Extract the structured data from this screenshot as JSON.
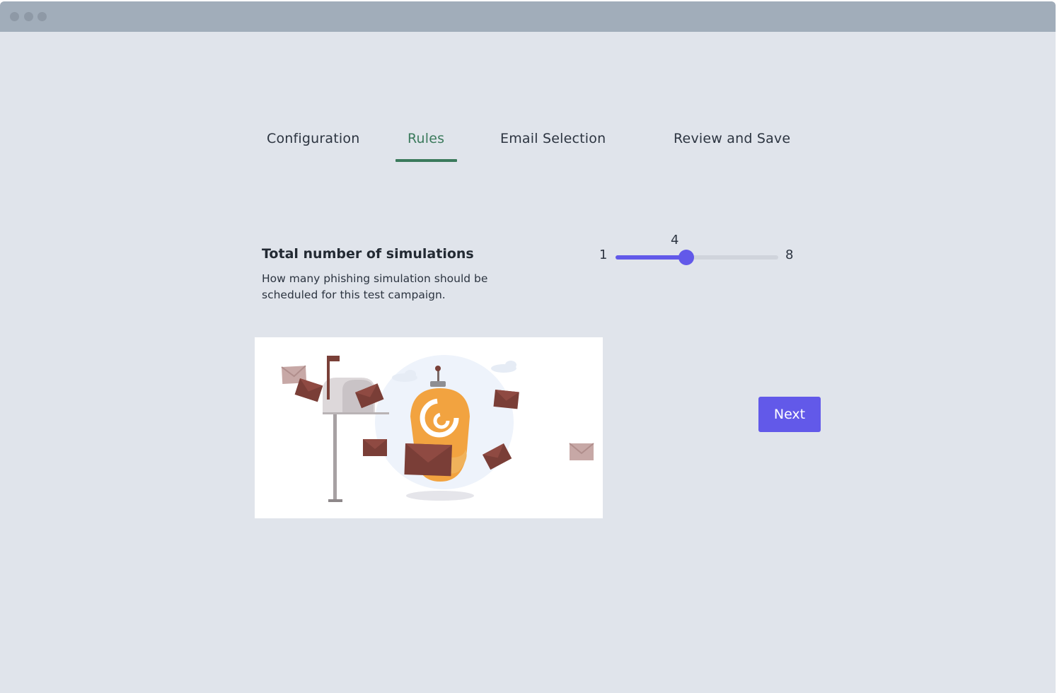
{
  "tabs": [
    {
      "label": "Configuration",
      "active": false
    },
    {
      "label": "Rules",
      "active": true
    },
    {
      "label": "Email Selection",
      "active": false
    },
    {
      "label": "Review and Save",
      "active": false
    }
  ],
  "rules": {
    "title": "Total number of simulations",
    "description": "How many phishing simulation should be scheduled for this test campaign."
  },
  "slider": {
    "min": 1,
    "max": 8,
    "value": 4
  },
  "next_label": "Next",
  "colors": {
    "accent": "#6259e9",
    "active_tab": "#3b7a5c",
    "background": "#e0e4eb",
    "titlebar": "#a1adba"
  }
}
